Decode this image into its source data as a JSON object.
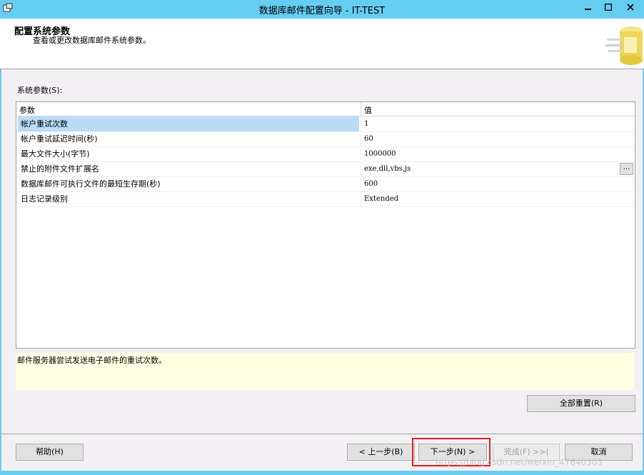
{
  "window": {
    "title": "数据库邮件配置向导 - IT-TEST",
    "controls": {
      "minimize": "—",
      "maximize": "□",
      "close": "✕"
    }
  },
  "header": {
    "title": "配置系统参数",
    "subtitle": "查看或更改数据库邮件系统参数。",
    "logo_icon": "database-mail-icon"
  },
  "params": {
    "label": "系统参数(S):",
    "columns": [
      "参数",
      "值"
    ],
    "rows": [
      {
        "name": "帐户重试次数",
        "value": "1",
        "selected": true
      },
      {
        "name": "帐户重试延迟时间(秒)",
        "value": "60"
      },
      {
        "name": "最大文件大小(字节)",
        "value": "1000000"
      },
      {
        "name": "禁止的附件文件扩展名",
        "value": "exe,dll,vbs,js",
        "has_button": true
      },
      {
        "name": "数据库邮件可执行文件的最短生存期(秒)",
        "value": "600"
      },
      {
        "name": "日志记录级别",
        "value": "Extended"
      }
    ],
    "ellipsis_label": "..."
  },
  "description": "邮件服务器尝试发送电子邮件的重试次数。",
  "buttons": {
    "reset_all": "全部重置(R)",
    "help": "帮助(H)",
    "back": "< 上一步(B)",
    "next": "下一步(N) >",
    "finish": "完成(F) >>|",
    "cancel": "取消"
  },
  "watermark": "https://blog.csdn.net/weixin_47640303"
}
